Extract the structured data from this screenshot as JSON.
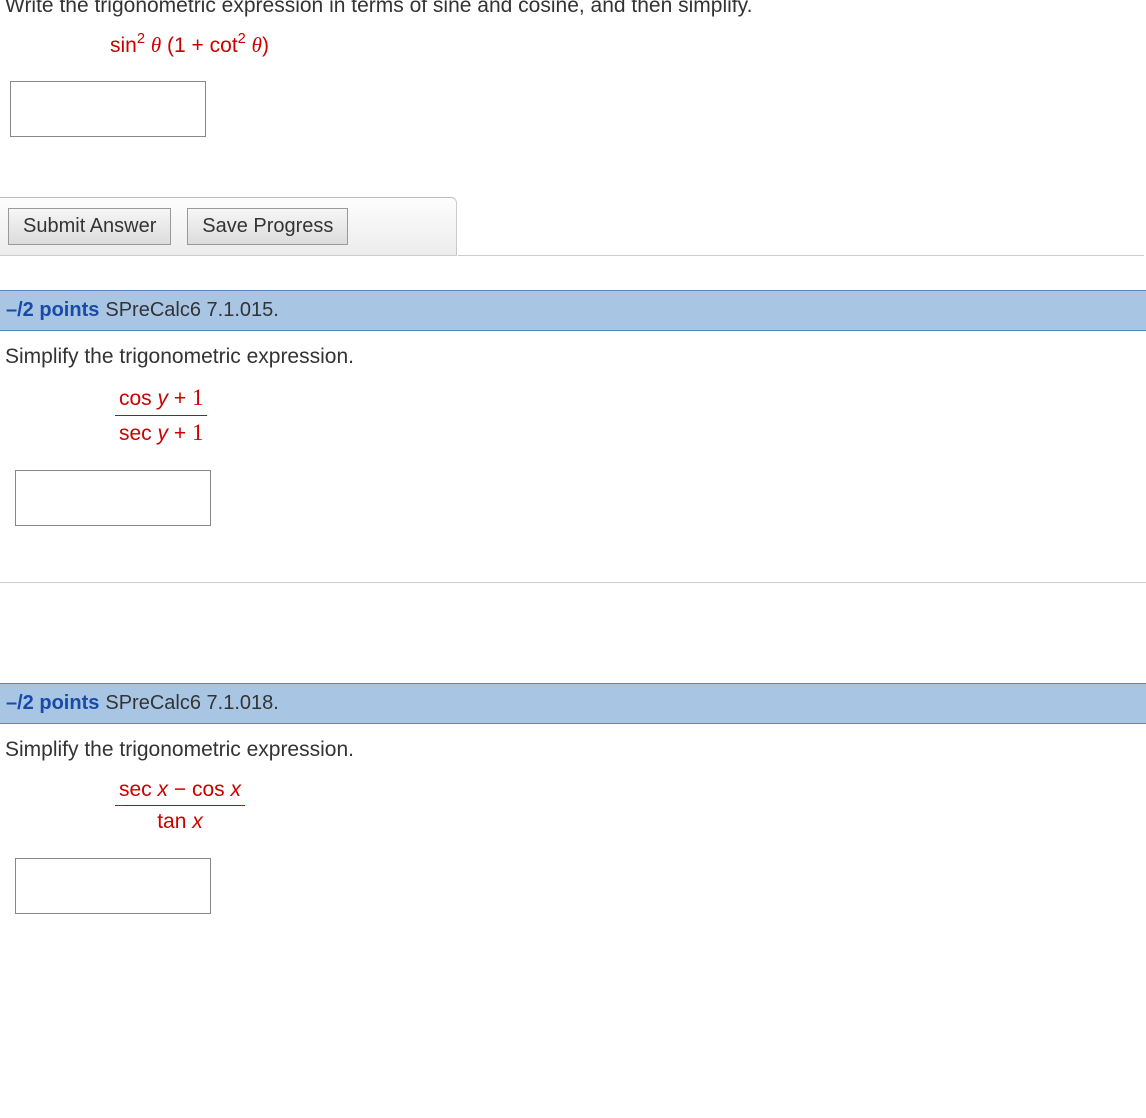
{
  "q1": {
    "prompt": "Write the trigonometric expression in terms of sine and cosine, and then simplify.",
    "expr_sin": "sin",
    "expr_exp": "2",
    "expr_theta": "θ",
    "expr_open": " (1 + cot",
    "expr_exp2": "2",
    "expr_theta2": "θ",
    "expr_close": ")",
    "answer": ""
  },
  "buttons": {
    "submit": "Submit Answer",
    "save": "Save Progress"
  },
  "q2": {
    "points": "–/2 points",
    "ref": "SPreCalc6 7.1.015.",
    "prompt": "Simplify the trigonometric expression.",
    "num_a": "cos ",
    "num_var": "y",
    "num_b": " + ",
    "num_one": "1",
    "den_a": "sec ",
    "den_var": "y",
    "den_b": " + ",
    "den_one": "1",
    "answer": ""
  },
  "q3": {
    "points": "–/2 points",
    "ref": "SPreCalc6 7.1.018.",
    "prompt": "Simplify the trigonometric expression.",
    "num_a": "sec ",
    "num_var": "x",
    "num_mid": " − cos ",
    "num_var2": "x",
    "den_a": "tan ",
    "den_var": "x",
    "answer": ""
  }
}
